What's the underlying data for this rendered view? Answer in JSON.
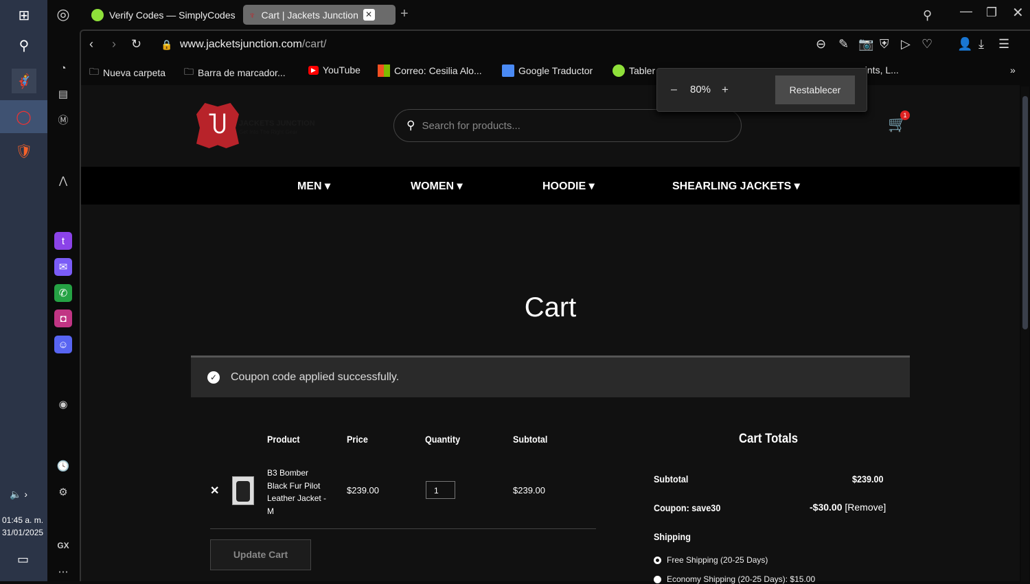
{
  "taskbar": {
    "time": "01:45 a. m.",
    "date": "31/01/2025"
  },
  "tabs": [
    {
      "label": "Verify Codes — SimplyCodes"
    },
    {
      "label": "Cart | Jackets Junction"
    }
  ],
  "address": {
    "url_host": "www.jacketsjunction.com",
    "url_path": "/cart/"
  },
  "bookmarks": [
    {
      "label": "Nueva carpeta"
    },
    {
      "label": "Barra de marcador..."
    },
    {
      "label": "YouTube"
    },
    {
      "label": "Correo: Cesilia Alo..."
    },
    {
      "label": "Google Traductor"
    },
    {
      "label": "Tabler"
    },
    {
      "label": "oints, L..."
    }
  ],
  "zoom_popup": {
    "minus": "–",
    "value": "80%",
    "plus": "+",
    "reset": "Restablecer"
  },
  "sidebar": {
    "gx": "GX"
  },
  "site": {
    "brand": "JACKETS JUNCTION",
    "tagline": "Get Into The Right Gear",
    "search_placeholder": "Search for products...",
    "cart_count": "1",
    "nav": [
      {
        "label": "MEN"
      },
      {
        "label": "WOMEN"
      },
      {
        "label": "HOODIE"
      },
      {
        "label": "SHEARLING JACKETS"
      }
    ]
  },
  "cart": {
    "title": "Cart",
    "notice": "Coupon code applied successfully.",
    "headers": {
      "product": "Product",
      "price": "Price",
      "quantity": "Quantity",
      "subtotal": "Subtotal"
    },
    "items": [
      {
        "name_lines": [
          "B3 Bomber",
          "Black Fur Pilot",
          "Leather Jacket -",
          "M"
        ],
        "price": "$239.00",
        "quantity": "1",
        "subtotal": "$239.00"
      }
    ],
    "update_label": "Update Cart"
  },
  "totals": {
    "title": "Cart Totals",
    "subtotal_label": "Subtotal",
    "subtotal": "$239.00",
    "coupon_label": "Coupon: save30",
    "coupon_value": "-$30.00",
    "remove": "[Remove]",
    "shipping_label": "Shipping",
    "shipping_options": [
      {
        "label": "Free Shipping (20-25 Days)",
        "selected": true
      },
      {
        "label": "Economy Shipping (20-25 Days): $15.00",
        "selected": false
      }
    ]
  }
}
